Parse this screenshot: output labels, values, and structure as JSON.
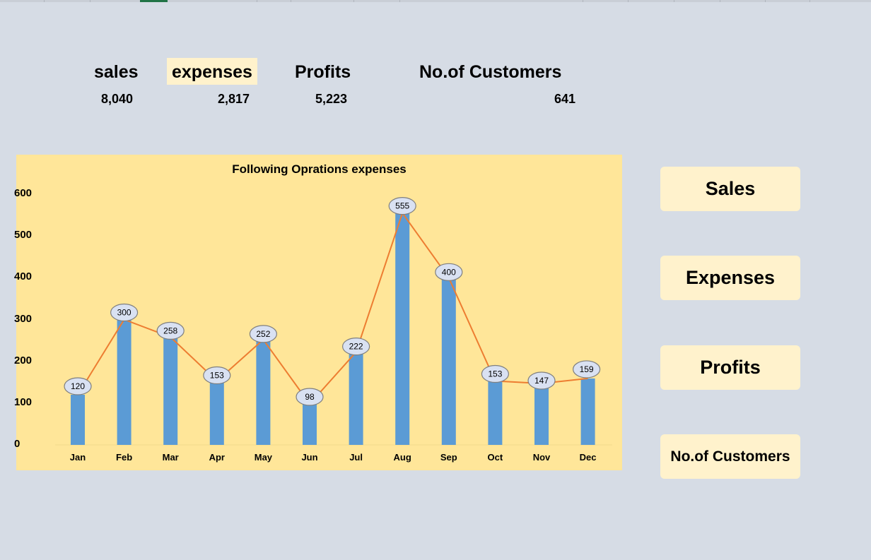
{
  "kpis": {
    "sales_label": "sales",
    "sales_value": "8,040",
    "expenses_label": "expenses",
    "expenses_value": "2,817",
    "profits_label": "Profits",
    "profits_value": "5,223",
    "customers_label": "No.of Customers",
    "customers_value": "641"
  },
  "buttons": {
    "sales": "Sales",
    "expenses": "Expenses",
    "profits": "Profits",
    "customers": "No.of Customers"
  },
  "colors": {
    "background": "#d6dce5",
    "chart_background": "#ffe699",
    "bar": "#5b9bd5",
    "line": "#ed7d31",
    "label_bubble": "#d9e1f2",
    "highlight": "#fff2cc"
  },
  "chart_data": {
    "type": "bar",
    "title": "Following Oprations expenses",
    "categories": [
      "Jan",
      "Feb",
      "Mar",
      "Apr",
      "May",
      "Jun",
      "Jul",
      "Aug",
      "Sep",
      "Oct",
      "Nov",
      "Dec"
    ],
    "series": [
      {
        "values": [
          120,
          300,
          258,
          153,
          252,
          98,
          222,
          555,
          400,
          153,
          147,
          159
        ]
      }
    ],
    "overlay_line": true,
    "data_labels": true,
    "ylim": [
      0,
      600
    ],
    "yticks": [
      0,
      100,
      200,
      300,
      400,
      500,
      600
    ],
    "grid": false,
    "legend": false
  }
}
